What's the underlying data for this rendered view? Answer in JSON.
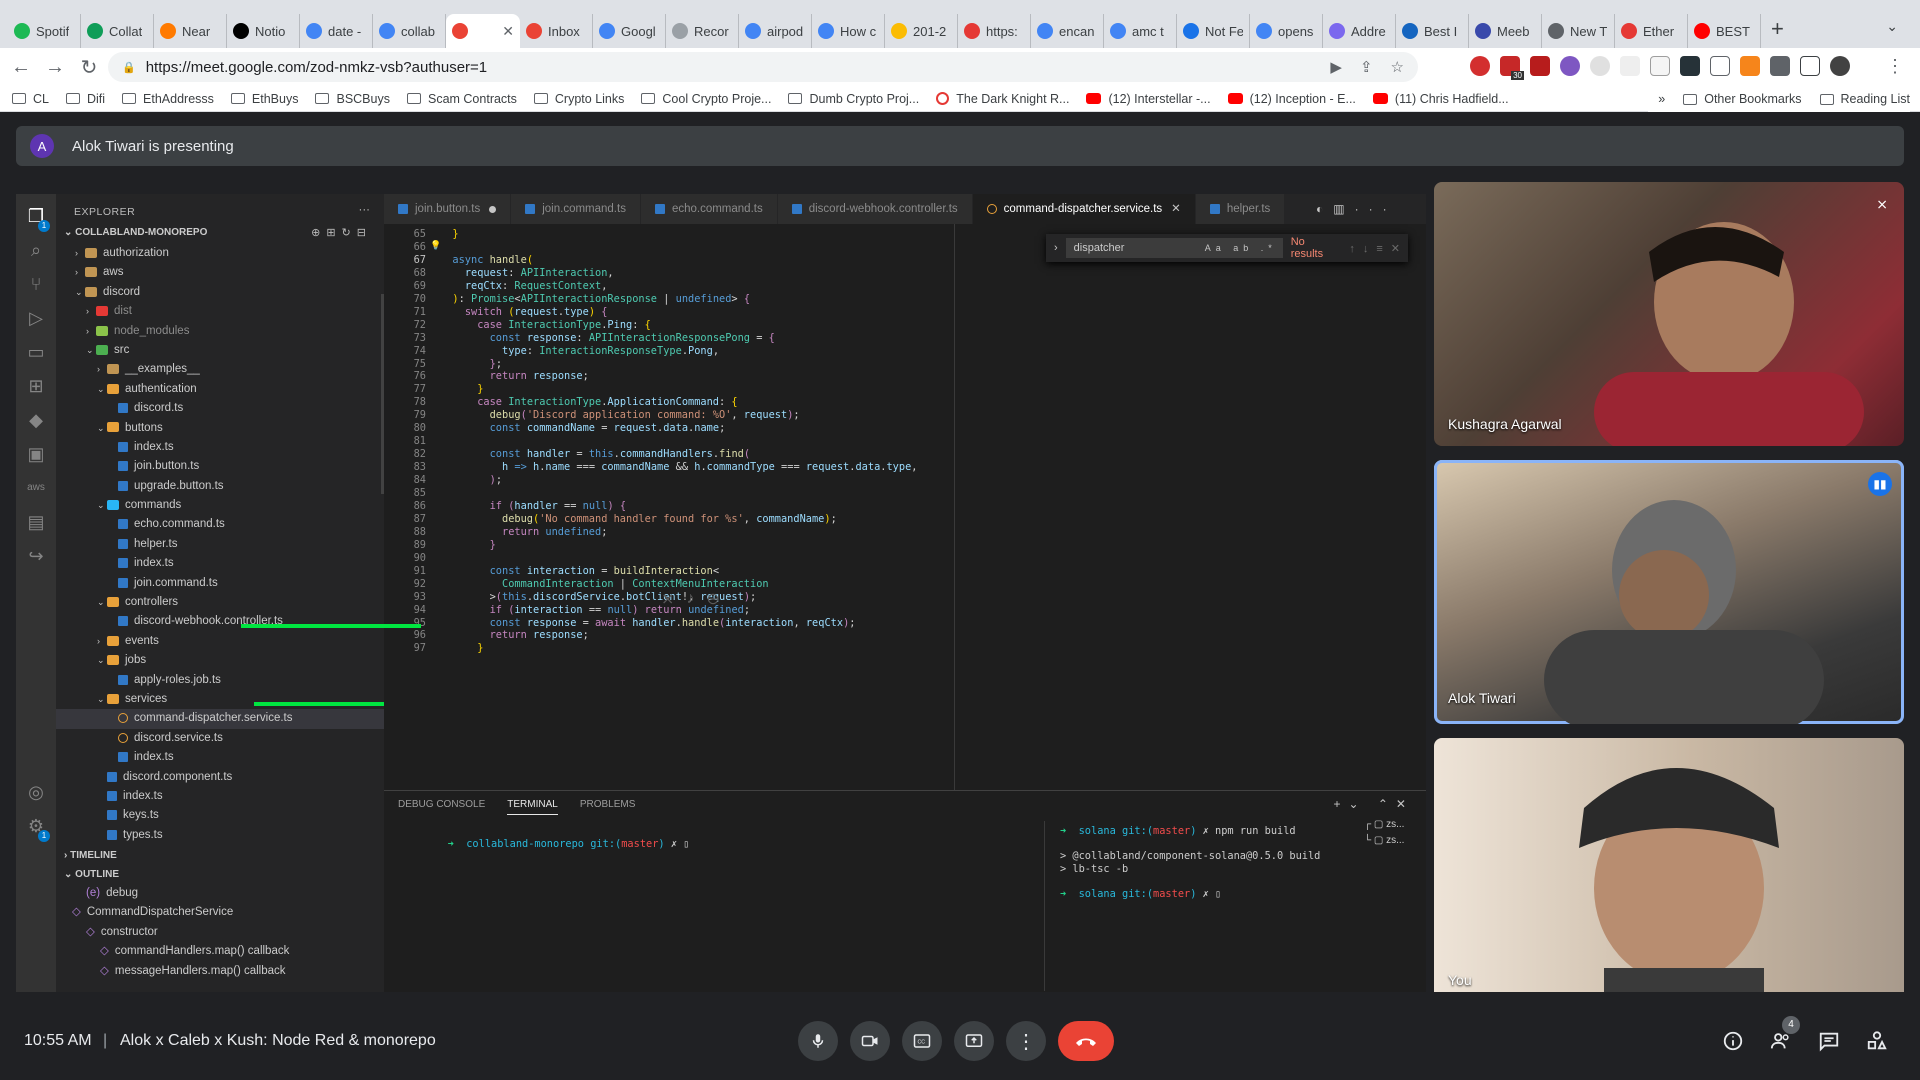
{
  "browser": {
    "tabs": [
      {
        "title": "Spotif",
        "color": "#1db954"
      },
      {
        "title": "Collat",
        "color": "#0f9d58"
      },
      {
        "title": "Near",
        "color": "#ff7a00"
      },
      {
        "title": "Notio",
        "color": "#000000"
      },
      {
        "title": "date -",
        "color": "#4285f4"
      },
      {
        "title": "collab",
        "color": "#4285f4"
      },
      {
        "title": "",
        "color": "#ea4335",
        "active": true
      },
      {
        "title": "Inbox",
        "color": "#ea4335"
      },
      {
        "title": "Googl",
        "color": "#4285f4"
      },
      {
        "title": "Recor",
        "color": "#9aa0a6"
      },
      {
        "title": "airpod",
        "color": "#4285f4"
      },
      {
        "title": "How c",
        "color": "#4285f4"
      },
      {
        "title": "201-2",
        "color": "#fbbc04"
      },
      {
        "title": "https:",
        "color": "#e53935"
      },
      {
        "title": "encan",
        "color": "#4285f4"
      },
      {
        "title": "amc t",
        "color": "#4285f4"
      },
      {
        "title": "Not Fe",
        "color": "#1a73e8"
      },
      {
        "title": "opens",
        "color": "#4285f4"
      },
      {
        "title": "Addre",
        "color": "#7b68ee"
      },
      {
        "title": "Best I",
        "color": "#1565c0"
      },
      {
        "title": "Meeb",
        "color": "#3949ab"
      },
      {
        "title": "New T",
        "color": "#5f6368"
      },
      {
        "title": "Ether",
        "color": "#e53935"
      },
      {
        "title": "BEST",
        "color": "#ff0000"
      }
    ],
    "url": "https://meet.google.com/zod-nmkz-vsb?authuser=1",
    "extension_badge": "30",
    "bookmarks": [
      {
        "label": "CL",
        "type": "folder"
      },
      {
        "label": "Difi",
        "type": "folder"
      },
      {
        "label": "EthAddresss",
        "type": "folder"
      },
      {
        "label": "EthBuys",
        "type": "folder"
      },
      {
        "label": "BSCBuys",
        "type": "folder"
      },
      {
        "label": "Scam Contracts",
        "type": "folder"
      },
      {
        "label": "Crypto Links",
        "type": "folder"
      },
      {
        "label": "Cool Crypto Proje...",
        "type": "folder"
      },
      {
        "label": "Dumb Crypto Proj...",
        "type": "folder"
      },
      {
        "label": "The Dark Knight R...",
        "type": "red"
      },
      {
        "label": "(12) Interstellar -...",
        "type": "yt"
      },
      {
        "label": "(12) Inception - E...",
        "type": "yt"
      },
      {
        "label": "(11) Chris Hadfield...",
        "type": "yt"
      }
    ],
    "bookmarks_right": {
      "more": "»",
      "other": "Other Bookmarks",
      "reading": "Reading List"
    }
  },
  "meet": {
    "presenter_initial": "A",
    "presenting_text": "Alok Tiwari is presenting",
    "time": "10:55 AM",
    "separator": "|",
    "meeting_title": "Alok x Caleb x Kush: Node Red & monorepo",
    "participant_count": "4",
    "participants": [
      {
        "name": "Kushagra Agarwal",
        "muted": true
      },
      {
        "name": "Alok Tiwari",
        "speaking": true
      },
      {
        "name": "You"
      }
    ]
  },
  "vscode": {
    "explorer_title": "EXPLORER",
    "project": "COLLABLAND-MONOREPO",
    "activity_badges": [
      "1",
      "1"
    ],
    "tree": [
      {
        "label": "authorization",
        "indent": 1,
        "kind": "folder",
        "open": false,
        "color": "#c09553"
      },
      {
        "label": "aws",
        "indent": 1,
        "kind": "folder",
        "open": false,
        "color": "#c09553"
      },
      {
        "label": "discord",
        "indent": 1,
        "kind": "folder",
        "open": true,
        "color": "#c09553"
      },
      {
        "label": "dist",
        "indent": 2,
        "kind": "folder",
        "open": false,
        "color": "#e53935",
        "dim": true
      },
      {
        "label": "node_modules",
        "indent": 2,
        "kind": "folder",
        "open": false,
        "color": "#8bc34a",
        "dim": true
      },
      {
        "label": "src",
        "indent": 2,
        "kind": "folder",
        "open": true,
        "color": "#4caf50"
      },
      {
        "label": "__examples__",
        "indent": 3,
        "kind": "folder",
        "open": false,
        "color": "#c09553"
      },
      {
        "label": "authentication",
        "indent": 3,
        "kind": "folder",
        "open": true,
        "color": "#e8a13a"
      },
      {
        "label": "discord.ts",
        "indent": 4,
        "kind": "ts"
      },
      {
        "label": "buttons",
        "indent": 3,
        "kind": "folder",
        "open": true,
        "color": "#e8a13a"
      },
      {
        "label": "index.ts",
        "indent": 4,
        "kind": "ts"
      },
      {
        "label": "join.button.ts",
        "indent": 4,
        "kind": "ts"
      },
      {
        "label": "upgrade.button.ts",
        "indent": 4,
        "kind": "ts"
      },
      {
        "label": "commands",
        "indent": 3,
        "kind": "folder",
        "open": true,
        "color": "#29b6f6"
      },
      {
        "label": "echo.command.ts",
        "indent": 4,
        "kind": "ts"
      },
      {
        "label": "helper.ts",
        "indent": 4,
        "kind": "ts"
      },
      {
        "label": "index.ts",
        "indent": 4,
        "kind": "ts"
      },
      {
        "label": "join.command.ts",
        "indent": 4,
        "kind": "ts"
      },
      {
        "label": "controllers",
        "indent": 3,
        "kind": "folder",
        "open": true,
        "color": "#e8a13a"
      },
      {
        "label": "discord-webhook.controller.ts",
        "indent": 4,
        "kind": "ts"
      },
      {
        "label": "events",
        "indent": 3,
        "kind": "folder",
        "open": false,
        "color": "#e8a13a"
      },
      {
        "label": "jobs",
        "indent": 3,
        "kind": "folder",
        "open": true,
        "color": "#e8a13a"
      },
      {
        "label": "apply-roles.job.ts",
        "indent": 4,
        "kind": "ts"
      },
      {
        "label": "services",
        "indent": 3,
        "kind": "folder",
        "open": true,
        "color": "#e8a13a"
      },
      {
        "label": "command-dispatcher.service.ts",
        "indent": 4,
        "kind": "svc",
        "selected": true
      },
      {
        "label": "discord.service.ts",
        "indent": 4,
        "kind": "svc"
      },
      {
        "label": "index.ts",
        "indent": 4,
        "kind": "ts"
      },
      {
        "label": "discord.component.ts",
        "indent": 3,
        "kind": "ts"
      },
      {
        "label": "index.ts",
        "indent": 3,
        "kind": "ts"
      },
      {
        "label": "keys.ts",
        "indent": 3,
        "kind": "ts"
      },
      {
        "label": "types.ts",
        "indent": 3,
        "kind": "ts"
      }
    ],
    "timeline_label": "TIMELINE",
    "outline_label": "OUTLINE",
    "outline": [
      {
        "label": "debug",
        "indent": 1,
        "mark": "(e)"
      },
      {
        "label": "CommandDispatcherService",
        "indent": 0,
        "mark": "◇"
      },
      {
        "label": "constructor",
        "indent": 1,
        "mark": "◇"
      },
      {
        "label": "commandHandlers.map() callback",
        "indent": 2,
        "mark": "◇"
      },
      {
        "label": "messageHandlers.map() callback",
        "indent": 2,
        "mark": "◇"
      }
    ],
    "editor_tabs": [
      {
        "label": "join.button.ts",
        "kind": "ts",
        "dirty": true
      },
      {
        "label": "join.command.ts",
        "kind": "ts"
      },
      {
        "label": "echo.command.ts",
        "kind": "ts"
      },
      {
        "label": "discord-webhook.controller.ts",
        "kind": "ts"
      },
      {
        "label": "command-dispatcher.service.ts",
        "kind": "svc",
        "active": true
      },
      {
        "label": "helper.ts",
        "kind": "ts"
      }
    ],
    "find": {
      "query": "dispatcher",
      "result": "No results"
    },
    "code_lines": [
      {
        "n": "65",
        "h": "  <span class='b'>}</span>"
      },
      {
        "n": "66",
        "h": ""
      },
      {
        "n": "67",
        "h": "  <span class='k'>async</span> <span class='f'>handle</span><span class='b'>(</span>",
        "cur": true
      },
      {
        "n": "68",
        "h": "    <span class='v'>request</span>: <span class='t'>APIInteraction</span>,"
      },
      {
        "n": "69",
        "h": "    <span class='v'>reqCtx</span>: <span class='t'>RequestContext</span>,"
      },
      {
        "n": "70",
        "h": "  <span class='b'>)</span>: <span class='t'>Promise</span>&lt;<span class='t'>APIInteractionResponse</span> | <span class='k'>undefined</span>&gt; <span class='kc'>{</span>"
      },
      {
        "n": "71",
        "h": "    <span class='kc'>switch</span> <span class='b'>(</span><span class='v'>request</span>.<span class='v'>type</span><span class='b'>)</span> <span class='kc'>{</span>"
      },
      {
        "n": "72",
        "h": "      <span class='kc'>case</span> <span class='t'>InteractionType</span>.<span class='v'>Ping</span>: <span class='b'>{</span>"
      },
      {
        "n": "73",
        "h": "        <span class='k'>const</span> <span class='v'>response</span>: <span class='t'>APIInteractionResponsePong</span> = <span class='kc'>{</span>"
      },
      {
        "n": "74",
        "h": "          <span class='v'>type</span>: <span class='t'>InteractionResponseType</span>.<span class='v'>Pong</span>,"
      },
      {
        "n": "75",
        "h": "        <span class='kc'>}</span>;"
      },
      {
        "n": "76",
        "h": "        <span class='kc'>return</span> <span class='v'>response</span>;"
      },
      {
        "n": "77",
        "h": "      <span class='b'>}</span>"
      },
      {
        "n": "78",
        "h": "      <span class='kc'>case</span> <span class='t'>InteractionType</span>.<span class='v'>ApplicationCommand</span>: <span class='b'>{</span>"
      },
      {
        "n": "79",
        "h": "        <span class='f'>debug</span><span class='kc'>(</span><span class='s'>'Discord application command: %O'</span>, <span class='v'>request</span><span class='kc'>)</span>;"
      },
      {
        "n": "80",
        "h": "        <span class='k'>const</span> <span class='v'>commandName</span> = <span class='v'>request</span>.<span class='v'>data</span>.<span class='v'>name</span>;"
      },
      {
        "n": "81",
        "h": ""
      },
      {
        "n": "82",
        "h": "        <span class='k'>const</span> <span class='v'>handler</span> = <span class='k'>this</span>.<span class='v'>commandHandlers</span>.<span class='f'>find</span><span class='kc'>(</span>"
      },
      {
        "n": "83",
        "h": "          <span class='v'>h</span> <span class='k'>=&gt;</span> <span class='v'>h</span>.<span class='v'>name</span> === <span class='v'>commandName</span> &amp;&amp; <span class='v'>h</span>.<span class='v'>commandType</span> === <span class='v'>request</span>.<span class='v'>data</span>.<span class='v'>type</span>,"
      },
      {
        "n": "84",
        "h": "        <span class='kc'>)</span>;"
      },
      {
        "n": "85",
        "h": ""
      },
      {
        "n": "86",
        "h": "        <span class='kc'>if</span> <span class='kc'>(</span><span class='v'>handler</span> == <span class='k'>null</span><span class='kc'>)</span> <span class='kc'>{</span>"
      },
      {
        "n": "87",
        "h": "          <span class='f'>debug</span><span class='b'>(</span><span class='s'>'No command handler found for %s'</span>, <span class='v'>commandName</span><span class='b'>)</span>;"
      },
      {
        "n": "88",
        "h": "          <span class='kc'>return</span> <span class='k'>undefined</span>;"
      },
      {
        "n": "89",
        "h": "        <span class='kc'>}</span>"
      },
      {
        "n": "90",
        "h": ""
      },
      {
        "n": "91",
        "h": "        <span class='k'>const</span> <span class='v'>interaction</span> = <span class='f'>buildInteraction</span>&lt;"
      },
      {
        "n": "92",
        "h": "          <span class='t'>CommandInteraction</span> | <span class='t'>ContextMenuInteraction</span>"
      },
      {
        "n": "93",
        "h": "        &gt;<span class='kc'>(</span><span class='k'>this</span>.<span class='v'>discordService</span>.<span class='v'>botClient</span>!, <span class='v'>request</span><span class='kc'>)</span>;"
      },
      {
        "n": "94",
        "h": "        <span class='kc'>if</span> <span class='kc'>(</span><span class='v'>interaction</span> == <span class='k'>null</span><span class='kc'>)</span> <span class='kc'>return</span> <span class='k'>undefined</span>;"
      },
      {
        "n": "95",
        "h": "        <span class='k'>const</span> <span class='v'>response</span> = <span class='kc'>await</span> <span class='v'>handler</span>.<span class='f'>handle</span><span class='kc'>(</span><span class='v'>interaction</span>, <span class='v'>reqCtx</span><span class='kc'>)</span>;"
      },
      {
        "n": "96",
        "h": "        <span class='kc'>return</span> <span class='v'>response</span>;"
      },
      {
        "n": "97",
        "h": "      <span class='b'>}</span>"
      }
    ],
    "panel_tabs": [
      "DEBUG CONSOLE",
      "TERMINAL",
      "PROBLEMS"
    ],
    "terminal_left": {
      "arrow": "➜",
      "dir": "collabland-monorepo",
      "git": "git:(",
      "branch": "master",
      "close": ")",
      "x": "✗"
    },
    "terminal_right": {
      "arrow": "➜",
      "dir": "solana",
      "git": "git:(",
      "branch": "master",
      "close": ")",
      "x": "✗",
      "cmd": "npm run build",
      "out1": "> @collabland/component-solana@0.5.0 build",
      "out2": "> lb-tsc -b"
    },
    "terminal_list": [
      "zs...",
      "zs..."
    ]
  }
}
